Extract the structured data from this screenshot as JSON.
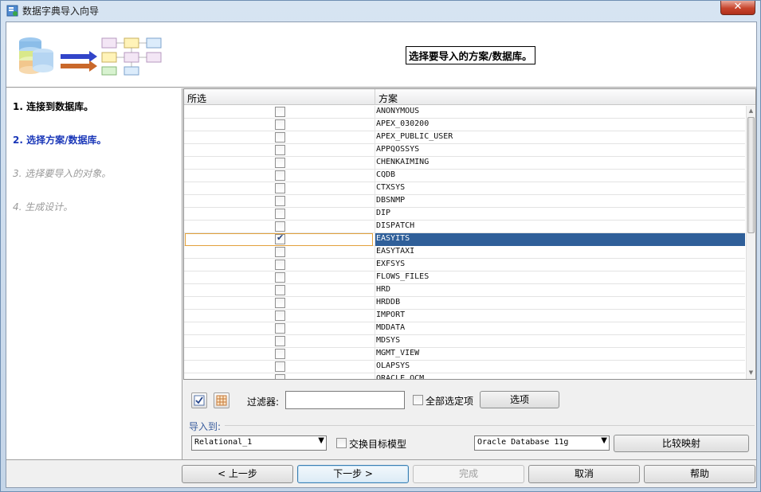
{
  "window": {
    "title": "数据字典导入向导",
    "close_glyph": "✕"
  },
  "header": {
    "caption": "选择要导入的方案/数据库。"
  },
  "steps": [
    {
      "label": "1. 连接到数据库。",
      "state": "done"
    },
    {
      "label": "2. 选择方案/数据库。",
      "state": "current"
    },
    {
      "label": "3. 选择要导入的对象。",
      "state": "pending"
    },
    {
      "label": "4. 生成设计。",
      "state": "pending"
    }
  ],
  "table": {
    "col_selected": "所选",
    "col_schema": "方案",
    "rows": [
      {
        "name": "ANONYMOUS",
        "checked": false
      },
      {
        "name": "APEX_030200",
        "checked": false
      },
      {
        "name": "APEX_PUBLIC_USER",
        "checked": false
      },
      {
        "name": "APPQOSSYS",
        "checked": false
      },
      {
        "name": "CHENKAIMING",
        "checked": false
      },
      {
        "name": "CQDB",
        "checked": false
      },
      {
        "name": "CTXSYS",
        "checked": false
      },
      {
        "name": "DBSNMP",
        "checked": false
      },
      {
        "name": "DIP",
        "checked": false
      },
      {
        "name": "DISPATCH",
        "checked": false
      },
      {
        "name": "EASYITS",
        "checked": true,
        "selected": true
      },
      {
        "name": "EASYTAXI",
        "checked": false
      },
      {
        "name": "EXFSYS",
        "checked": false
      },
      {
        "name": "FLOWS_FILES",
        "checked": false
      },
      {
        "name": "HRD",
        "checked": false
      },
      {
        "name": "HRDDB",
        "checked": false
      },
      {
        "name": "IMPORT",
        "checked": false
      },
      {
        "name": "MDDATA",
        "checked": false
      },
      {
        "name": "MDSYS",
        "checked": false
      },
      {
        "name": "MGMT_VIEW",
        "checked": false
      },
      {
        "name": "OLAPSYS",
        "checked": false
      },
      {
        "name": "ORACLE_OCM",
        "checked": false
      }
    ]
  },
  "filter": {
    "label": "过滤器:",
    "value": "",
    "select_all_label": "全部选定项",
    "options_button": "选项"
  },
  "import_to": {
    "label": "导入到:",
    "model": "Relational_1",
    "swap_label": "交换目标模型",
    "db_version": "Oracle Database 11g",
    "compare_button": "比较映射"
  },
  "footer": {
    "back": "< 上一步",
    "next": "下一步 >",
    "finish": "完成",
    "cancel": "取消",
    "help": "帮助"
  },
  "colors": {
    "selection": "#2f5f99",
    "current_step": "#1a37b8",
    "pending_step": "#9a9a9a"
  }
}
